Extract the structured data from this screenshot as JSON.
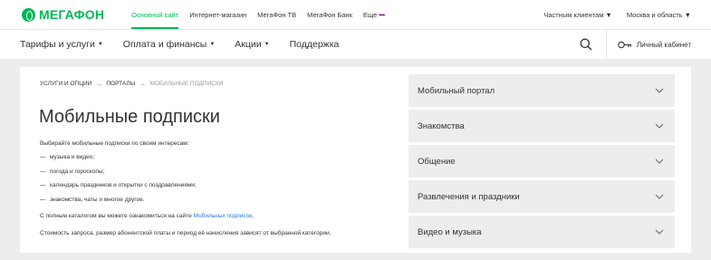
{
  "brand": {
    "name": "МегаФон",
    "color": "#00b956",
    "accent": "#731982"
  },
  "topbar": {
    "links": [
      {
        "label": "Основной сайт",
        "active": true
      },
      {
        "label": "Интернет-магазин",
        "active": false
      },
      {
        "label": "МегаФон ТВ",
        "active": false
      },
      {
        "label": "МегаФон Банк",
        "active": false
      },
      {
        "label": "Еще",
        "active": false
      }
    ],
    "more_dots": "•••",
    "clients": "Частным клиентам",
    "region": "Москва и область"
  },
  "nav": {
    "items": [
      {
        "label": "Тарифы и услуги",
        "has_dropdown": true
      },
      {
        "label": "Оплата и финансы",
        "has_dropdown": true
      },
      {
        "label": "Акции",
        "has_dropdown": true
      },
      {
        "label": "Поддержка",
        "has_dropdown": false
      }
    ],
    "search_icon": "search-icon",
    "account_label": "Личный кабинет",
    "account_icon": "key-icon"
  },
  "breadcrumb": [
    "УСЛУГИ И ОПЦИИ",
    "ПОРТАЛЫ",
    "МОБИЛЬНЫЕ ПОДПИСКИ"
  ],
  "content": {
    "title": "Мобильные подписки",
    "intro": "Выбирайте мобильные подписки по своим интересам:",
    "bullets": [
      "музыка и видео;",
      "погода и гороскопы;",
      "календарь праздников и открытки с поздравлениями;",
      "знакомства, чаты и многое другое."
    ],
    "catalog_prefix": "С полным каталогом вы можете ознакомиться на сайте ",
    "catalog_link": "Мобильных подписок",
    "catalog_suffix": ".",
    "cost_note": "Стоимость запроса, размер абонентской платы и период её начисления зависят от выбранной категории."
  },
  "accordion": [
    "Мобильный портал",
    "Знакомства",
    "Общение",
    "Развлечения и праздники",
    "Видео и музыка"
  ]
}
